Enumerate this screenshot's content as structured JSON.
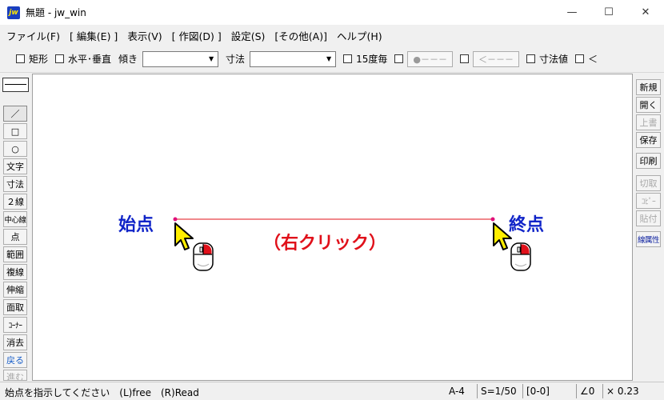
{
  "window": {
    "title": "無題 - jw_win",
    "icon_text": "jw",
    "controls": {
      "minimize": "—",
      "maximize": "☐",
      "close": "✕"
    }
  },
  "menu": [
    {
      "label": "ファイル(F)"
    },
    {
      "label": "[ 編集(E) ]"
    },
    {
      "label": "表示(V)"
    },
    {
      "label": "[ 作図(D) ]"
    },
    {
      "label": "設定(S)"
    },
    {
      "label": "[その他(A)]"
    },
    {
      "label": "ヘルプ(H)"
    }
  ],
  "toolbar": {
    "rect_label": "矩形",
    "hv_label": "水平･垂直",
    "angle_label": "傾き",
    "angle_value": "",
    "dim_label": "寸法",
    "dim_value": "",
    "deg15_label": "15度毎",
    "btn_point_line": "●－－－",
    "btn_arrow_line": "＜－－－",
    "dimval_label": "寸法値",
    "lt_label": "＜"
  },
  "left_tools": {
    "line": "／",
    "rect": "□",
    "circle": "○",
    "text": "文字",
    "dim": "寸法",
    "double": "２線",
    "center": "中心線",
    "point": "点",
    "range": "範囲",
    "copy_line": "複線",
    "stretch": "伸縮",
    "chamfer": "面取",
    "corner": "ｺｰﾅｰ",
    "erase": "消去",
    "back": "戻る",
    "forward": "進む"
  },
  "right_tools": {
    "new": "新規",
    "open": "開く",
    "overwrite": "上書",
    "save": "保存",
    "print": "印刷",
    "cut": "切取",
    "copy": "ｺﾋﾟｰ",
    "paste": "貼付",
    "line_attr": "線属性"
  },
  "canvas": {
    "start_label": "始点",
    "end_label": "終点",
    "instruction": "（右クリック）",
    "line_color": "#e0101a",
    "label_color": "#1024c8"
  },
  "status": {
    "message": "始点を指示してください　(L)free　(R)Read",
    "paper": "A-4",
    "scale": "S=1/50",
    "layer": "[0-0]",
    "angle": "∠0",
    "zoom": "× 0.23"
  }
}
